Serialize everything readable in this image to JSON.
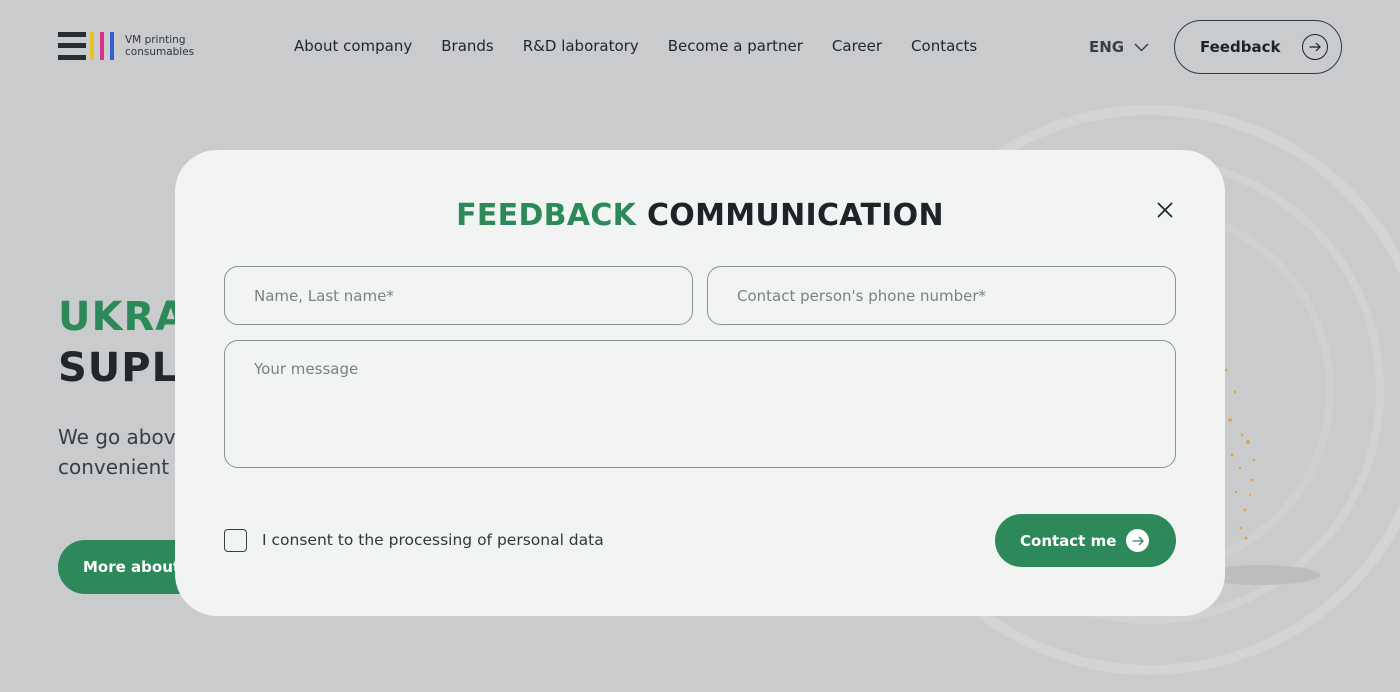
{
  "colors": {
    "accent_green": "#2d8959",
    "title_green": "#2b8a57",
    "dark": "#1f2226",
    "page_background": "#cacbcd",
    "modal_background": "#f1f4f3",
    "logo_stripes": [
      "#e9c225",
      "#dd2e8a",
      "#2f5fd0"
    ]
  },
  "header": {
    "logo_text_line1": "VM printing",
    "logo_text_line2": "consumables",
    "nav": [
      "About company",
      "Brands",
      "R&D laboratory",
      "Become a partner",
      "Career",
      "Contacts"
    ],
    "lang": "ENG",
    "feedback_label": "Feedback",
    "icons": {
      "lang": "chevron-down-icon",
      "feedback": "arrow-right-circle-icon"
    }
  },
  "hero": {
    "line1": "UKRA",
    "line2": "SUPLI",
    "text_line1": "We go above",
    "text_line2": "convenient f",
    "button_label": "More about t"
  },
  "modal": {
    "title_green": "FEEDBACK",
    "title_dark": "COMMUNICATION",
    "name_placeholder": "Name, Last name*",
    "name_value": "",
    "phone_placeholder": "Contact person's phone number*",
    "phone_value": "",
    "message_placeholder": "Your message",
    "message_value": "",
    "consent_label": "I consent to the processing of personal data",
    "consent_checked": false,
    "submit_label": "Contact me",
    "icons": {
      "close": "close-icon",
      "submit": "arrow-right-icon"
    }
  }
}
